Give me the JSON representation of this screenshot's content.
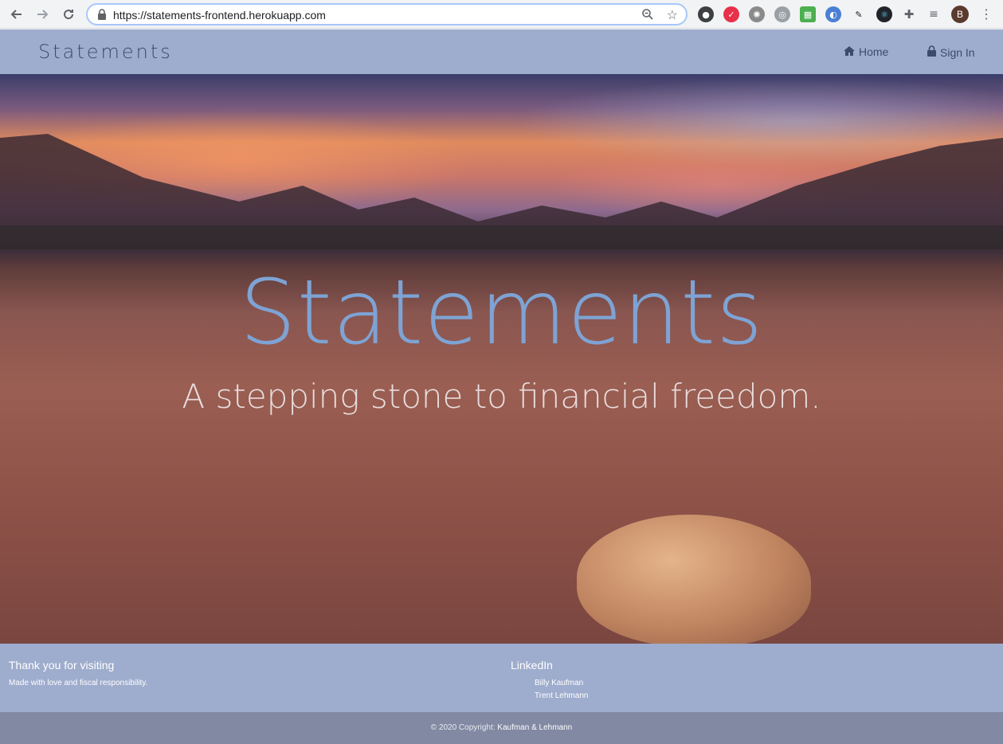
{
  "browser": {
    "url": "https://statements-frontend.herokuapp.com",
    "profile_initial": "B",
    "icons": [
      "back-icon",
      "forward-icon",
      "reload-icon",
      "lock-icon",
      "zoom-icon",
      "bookmark-star-icon",
      "extensions-icon",
      "menu-kebab-icon"
    ]
  },
  "navbar": {
    "brand": "Statements",
    "links": [
      {
        "label": "Home",
        "icon": "home-icon"
      },
      {
        "label": "Sign In",
        "icon": "lock-icon"
      }
    ]
  },
  "hero": {
    "title": "Statements",
    "subtitle": "A stepping stone to financial freedom."
  },
  "footer": {
    "left_heading": "Thank you for visiting",
    "left_text": "Made with love and fiscal responsibility.",
    "right_heading": "LinkedIn",
    "links": [
      "Billy Kaufman",
      "Trent Lehmann"
    ]
  },
  "copyright": {
    "prefix": "© 2020 Copyright: ",
    "owners": "Kaufman & Lehmann"
  },
  "colors": {
    "navbar_bg": "#9eaccd",
    "hero_title": "#7ea3d4",
    "copyright_bg": "#8189a3"
  }
}
